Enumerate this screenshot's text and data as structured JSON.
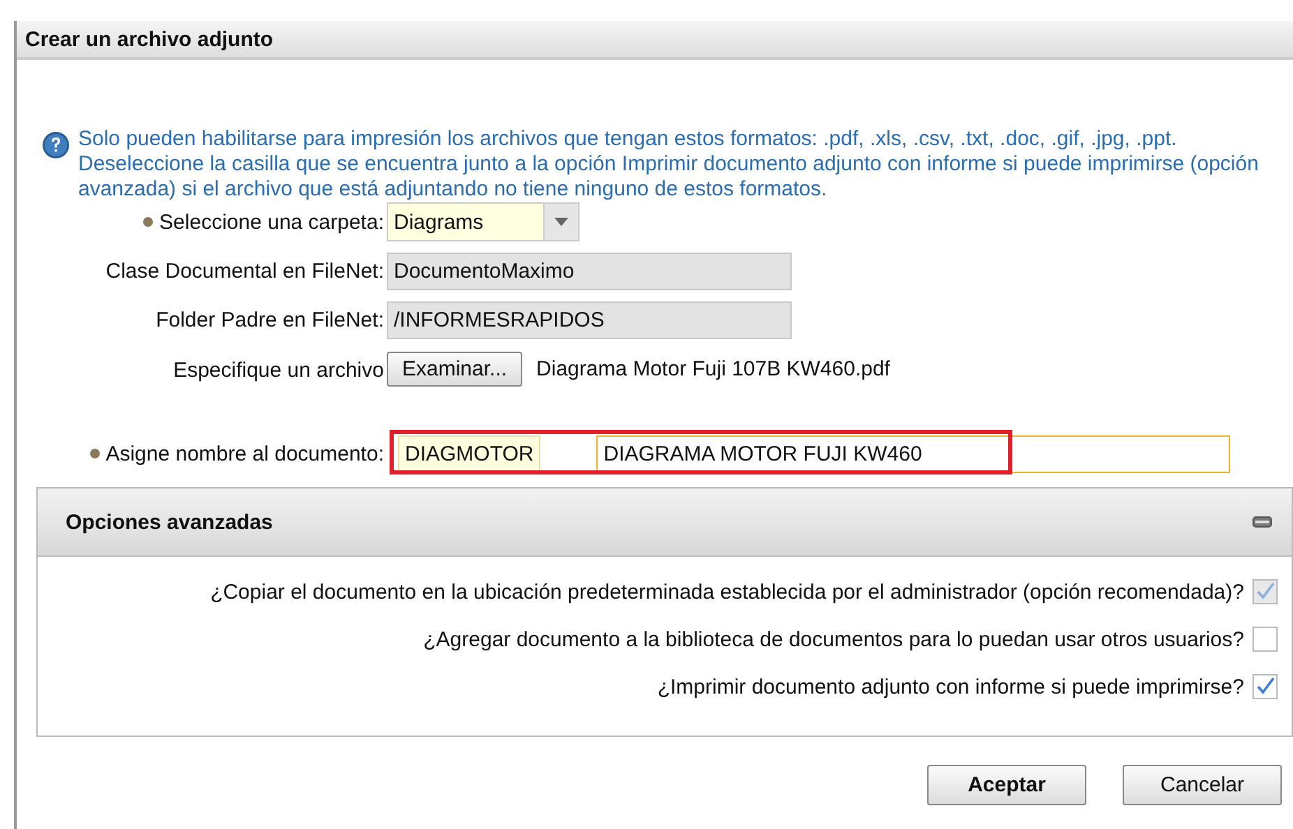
{
  "window": {
    "title": "Crear un archivo adjunto"
  },
  "info": "Solo pueden habilitarse para impresión los archivos que tengan estos formatos: .pdf, .xls, .csv, .txt, .doc, .gif, .jpg, .ppt. Deseleccione la casilla que se encuentra junto a la opción Imprimir documento adjunto con informe si puede imprimirse (opción avanzada) si el archivo que está adjuntando no tiene ninguno de estos formatos.",
  "fields": [
    {
      "kind": "select",
      "label": "Seleccione una carpeta:",
      "required": true,
      "value": "Diagrams"
    },
    {
      "kind": "readonly",
      "label": "Clase Documental en FileNet:",
      "required": false,
      "value": "DocumentoMaximo"
    },
    {
      "kind": "readonly",
      "label": "Folder Padre en FileNet:",
      "required": false,
      "value": "/INFORMESRAPIDOS"
    },
    {
      "kind": "file",
      "label": "Especifique un archivo",
      "required": false,
      "button": "Examinar...",
      "value": "Diagrama Motor Fuji 107B KW460.pdf"
    },
    {
      "kind": "name",
      "label": "Asigne nombre al documento:",
      "required": true,
      "code": "DIAGMOTOR",
      "value": "DIAGRAMA MOTOR FUJI KW460",
      "highlighted": true
    }
  ],
  "advanced": {
    "title": "Opciones avanzadas",
    "expanded": true,
    "options": [
      {
        "label": "¿Copiar el documento en la ubicación predeterminada establecida por el administrador (opción recomendada)?",
        "checked": true,
        "disabled": true
      },
      {
        "label": "¿Agregar documento a la biblioteca de documentos para lo puedan usar otros usuarios?",
        "checked": false,
        "disabled": false
      },
      {
        "label": "¿Imprimir documento adjunto con informe si puede imprimirse?",
        "checked": true,
        "disabled": false
      }
    ]
  },
  "buttons": [
    {
      "label": "Aceptar",
      "primary": true
    },
    {
      "label": "Cancelar",
      "primary": false
    }
  ]
}
